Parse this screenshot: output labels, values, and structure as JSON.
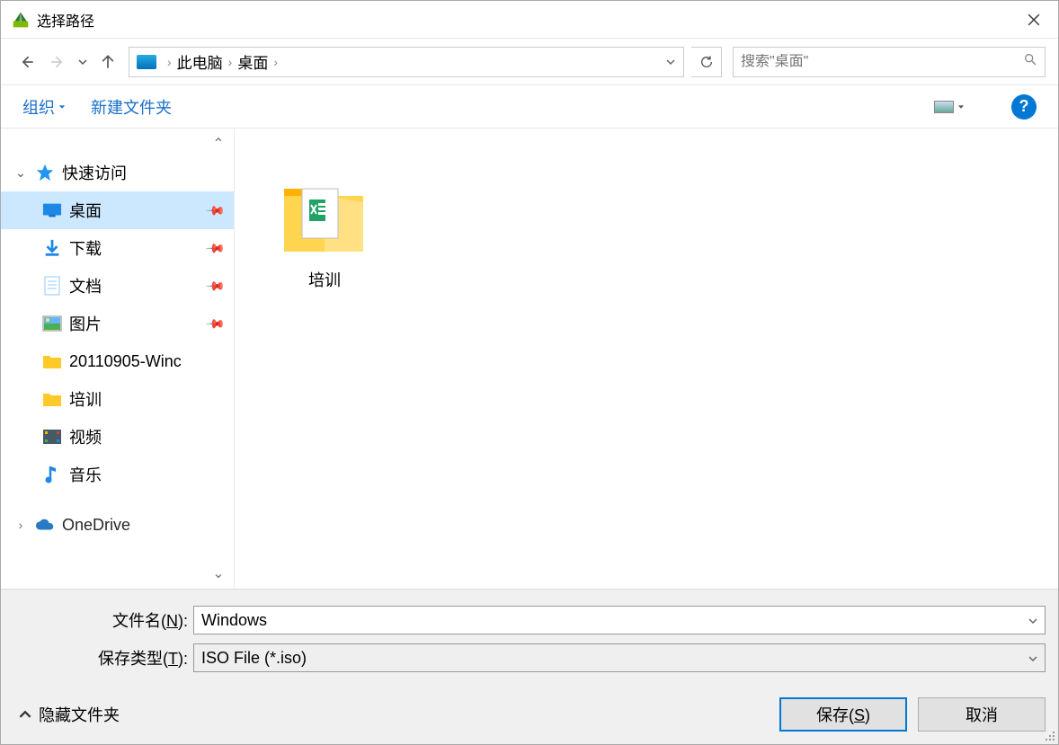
{
  "window": {
    "title": "选择路径"
  },
  "breadcrumb": {
    "pc": "此电脑",
    "desktop": "桌面"
  },
  "search": {
    "placeholder": "搜索\"桌面\""
  },
  "toolbar": {
    "organize": "组织",
    "newfolder": "新建文件夹"
  },
  "sidebar": {
    "quickaccess": "快速访问",
    "items": [
      {
        "label": "桌面",
        "pinned": true
      },
      {
        "label": "下载",
        "pinned": true
      },
      {
        "label": "文档",
        "pinned": true
      },
      {
        "label": "图片",
        "pinned": true
      },
      {
        "label": "20110905-Winc",
        "pinned": false
      },
      {
        "label": "培训",
        "pinned": false
      },
      {
        "label": "视频",
        "pinned": false
      },
      {
        "label": "音乐",
        "pinned": false
      }
    ],
    "onedrive": "OneDrive"
  },
  "content": {
    "folder1": "培训"
  },
  "filepanel": {
    "filename_label_pre": "文件名(",
    "filename_label_u": "N",
    "filename_label_post": "):",
    "filename_value": "Windows",
    "filetype_label_pre": "保存类型(",
    "filetype_label_u": "T",
    "filetype_label_post": "):",
    "filetype_value": "ISO File (*.iso)"
  },
  "footer": {
    "hidefolders": "隐藏文件夹",
    "save_pre": "保存(",
    "save_u": "S",
    "save_post": ")",
    "cancel": "取消"
  }
}
